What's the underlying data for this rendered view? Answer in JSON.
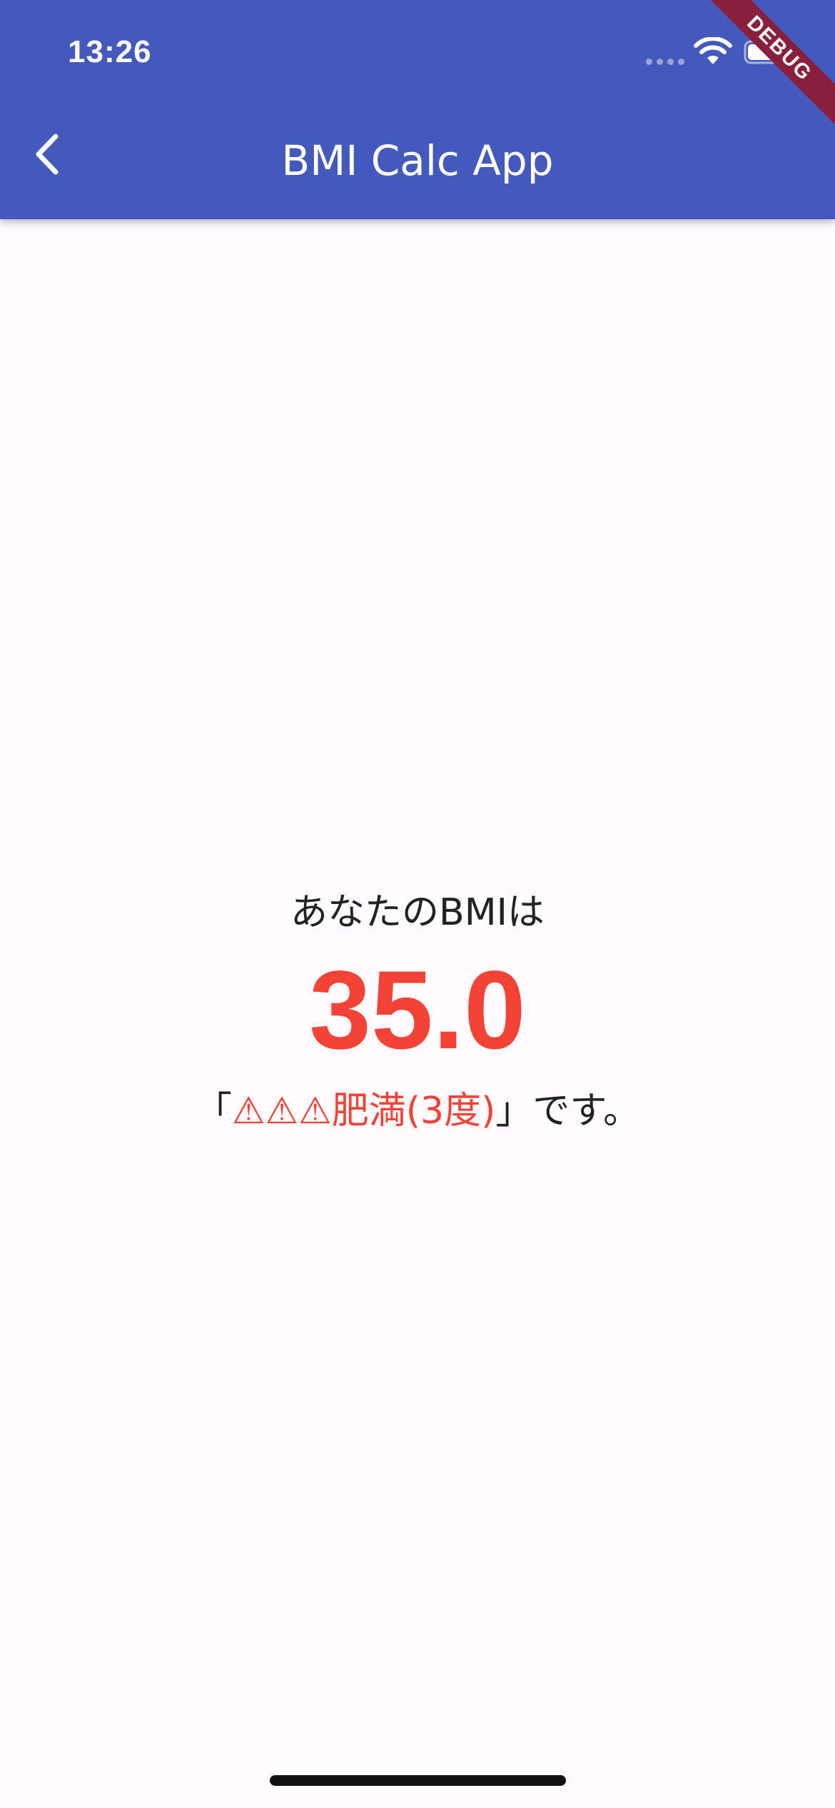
{
  "status_bar": {
    "time": "13:26"
  },
  "app_bar": {
    "title": "BMI Calc App",
    "back_icon": "chevron-left-icon",
    "background_color": "#4459bc"
  },
  "debug_banner": {
    "label": "DEBUG",
    "color": "#8a1f3b"
  },
  "result": {
    "intro": "あなたのBMIは",
    "bmi_value": "35.0",
    "open_bracket": "「",
    "category": "⚠⚠⚠肥満(3度)",
    "close_suffix": "」です。",
    "accent_color": "#f44336"
  }
}
